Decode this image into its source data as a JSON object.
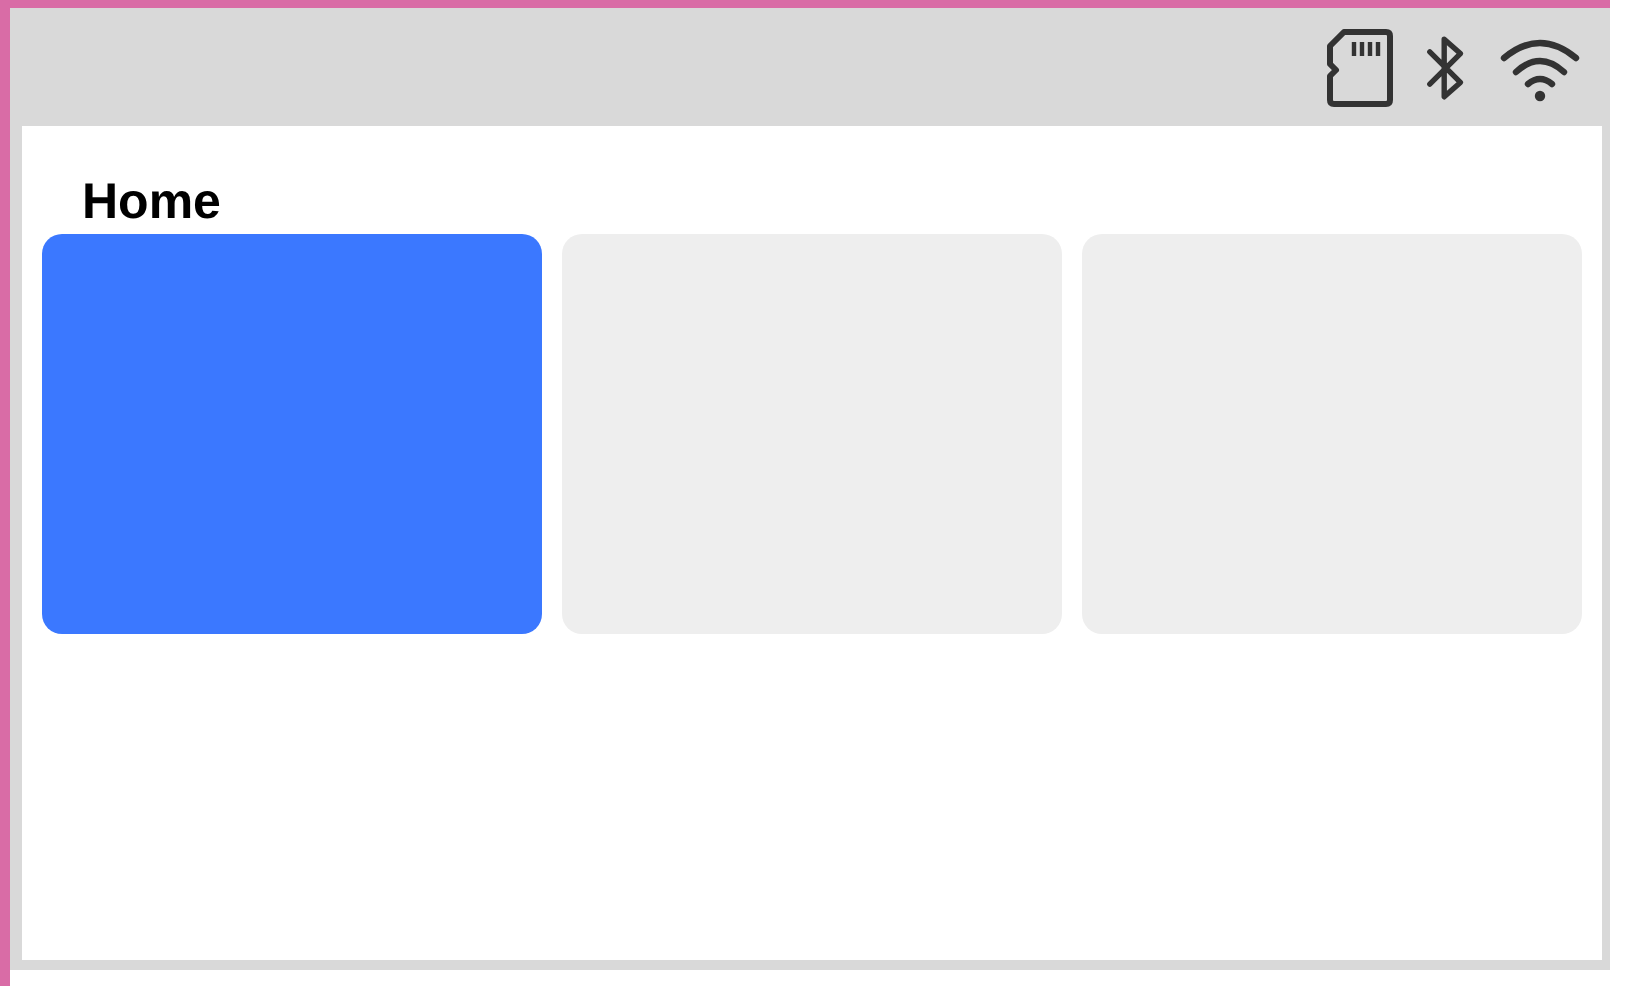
{
  "status_icons": [
    {
      "kind": "sd-card"
    },
    {
      "kind": "bluetooth"
    },
    {
      "kind": "wifi"
    }
  ],
  "title": "Home",
  "tiles": [
    {
      "selected": true
    },
    {
      "selected": false
    },
    {
      "selected": false
    }
  ]
}
